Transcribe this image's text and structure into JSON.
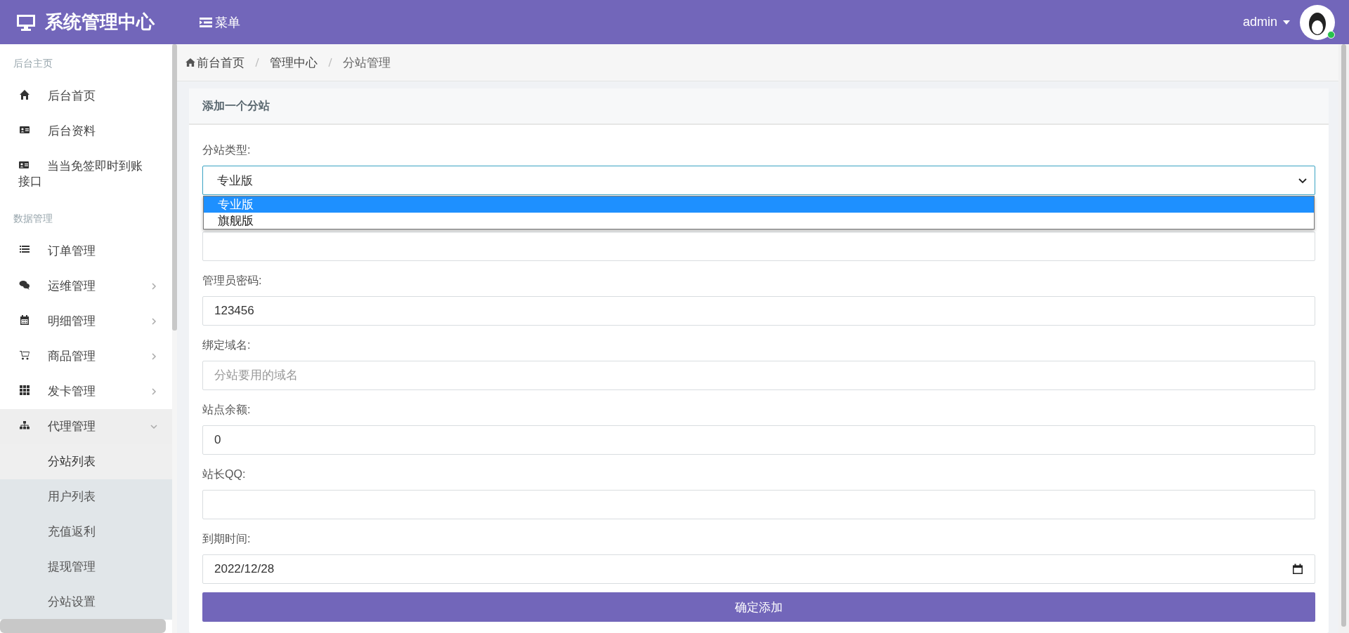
{
  "header": {
    "title": "系统管理中心",
    "menu_label": "菜单",
    "user": "admin",
    "online": true
  },
  "sidebar": {
    "sections": [
      {
        "title": "后台主页",
        "items": [
          {
            "label": "后台首页",
            "expandable": false,
            "expanded": false,
            "selected": false
          },
          {
            "label": "后台资料",
            "expandable": false,
            "expanded": false,
            "selected": false
          },
          {
            "label": "当当免签即时到账接口",
            "expandable": false,
            "expanded": false,
            "selected": false
          }
        ]
      },
      {
        "title": "数据管理",
        "items": [
          {
            "label": "订单管理",
            "expandable": false,
            "expanded": false,
            "selected": false
          },
          {
            "label": "运维管理",
            "expandable": true,
            "expanded": false,
            "selected": false
          },
          {
            "label": "明细管理",
            "expandable": true,
            "expanded": false,
            "selected": false
          },
          {
            "label": "商品管理",
            "expandable": true,
            "expanded": false,
            "selected": false
          },
          {
            "label": "发卡管理",
            "expandable": true,
            "expanded": false,
            "selected": false
          },
          {
            "label": "代理管理",
            "expandable": true,
            "expanded": true,
            "selected": false,
            "children": [
              {
                "label": "分站列表",
                "selected": true
              },
              {
                "label": "用户列表",
                "selected": false
              },
              {
                "label": "充值返利",
                "selected": false
              },
              {
                "label": "提现管理",
                "selected": false
              },
              {
                "label": "分站设置",
                "selected": false
              }
            ]
          }
        ]
      }
    ]
  },
  "breadcrumb": [
    "前台首页",
    "管理中心",
    "分站管理"
  ],
  "card": {
    "title": "添加一个分站",
    "fields": [
      {
        "kind": "select",
        "label": "分站类型:",
        "value": "专业版",
        "expanded": true,
        "options": [
          {
            "label": "专业版",
            "selected": true
          },
          {
            "label": "旗舰版",
            "selected": false
          }
        ]
      },
      {
        "kind": "text"
      },
      {
        "kind": "text",
        "label": "管理员密码:",
        "value": "123456"
      },
      {
        "kind": "text",
        "label": "绑定域名:",
        "placeholder": "分站要用的域名"
      },
      {
        "kind": "text",
        "label": "站点余额:",
        "value": "0"
      },
      {
        "kind": "text",
        "label": "站长QQ:"
      },
      {
        "kind": "date",
        "label": "到期时间:",
        "value": "2022/12/28"
      }
    ],
    "submit": "确定添加"
  }
}
